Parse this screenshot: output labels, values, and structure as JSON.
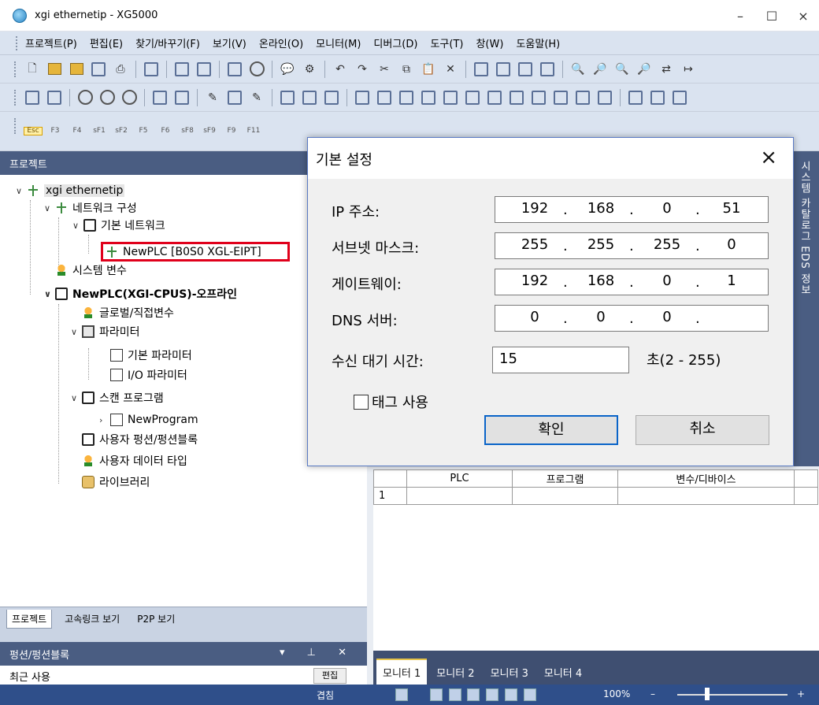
{
  "window": {
    "title": "xgi ethernetip - XG5000",
    "min": "–",
    "max": "☐",
    "close": "×"
  },
  "menu": [
    "프로젝트(P)",
    "편집(E)",
    "찾기/바꾸기(F)",
    "보기(V)",
    "온라인(O)",
    "모니터(M)",
    "디버그(D)",
    "도구(T)",
    "창(W)",
    "도움말(H)"
  ],
  "toolbar_keys": [
    {
      "top": "Esc",
      "bottom": ""
    },
    {
      "top": "F3",
      "bottom": ""
    },
    {
      "top": "F4",
      "bottom": ""
    },
    {
      "top": "sF1",
      "bottom": ""
    },
    {
      "top": "sF2",
      "bottom": ""
    },
    {
      "top": "F5",
      "bottom": ""
    },
    {
      "top": "F6",
      "bottom": ""
    },
    {
      "top": "sF8",
      "bottom": ""
    },
    {
      "top": "sF9",
      "bottom": ""
    },
    {
      "top": "F9",
      "bottom": ""
    },
    {
      "top": "F11",
      "bottom": ""
    }
  ],
  "project_pane": {
    "title": "프로젝트",
    "tree": [
      {
        "label": "xgi ethernetip",
        "icon": "network-icon"
      },
      {
        "label": "네트워크 구성",
        "icon": "network-config-icon"
      },
      {
        "label": "기본 네트워크",
        "icon": "basic-network-icon"
      },
      {
        "label": "NewPLC [B0S0 XGL-EIPT]",
        "icon": "module-icon"
      },
      {
        "label": "시스템 변수",
        "icon": "system-variable-icon"
      },
      {
        "label": "NewPLC(XGI-CPUS)-오프라인",
        "icon": "plc-icon"
      },
      {
        "label": "글로벌/직접변수",
        "icon": "global-variable-icon"
      },
      {
        "label": "파라미터",
        "icon": "parameter-icon"
      },
      {
        "label": "기본 파라미터",
        "icon": "basic-parameter-icon"
      },
      {
        "label": "I/O 파라미터",
        "icon": "io-parameter-icon"
      },
      {
        "label": "스캔 프로그램",
        "icon": "scan-program-icon"
      },
      {
        "label": "NewProgram",
        "icon": "program-icon"
      },
      {
        "label": "사용자 펑션/펑션블록",
        "icon": "user-function-icon"
      },
      {
        "label": "사용자 데이터 타입",
        "icon": "user-datatype-icon"
      },
      {
        "label": "라이브러리",
        "icon": "library-icon"
      }
    ],
    "bottom_tabs": [
      "프로젝트",
      "고속링크 보기",
      "P2P 보기"
    ]
  },
  "function_pane": {
    "title": "펑션/펑션블록",
    "recent": "최근 사용",
    "edit_button": "편집"
  },
  "side_strip": "시스템 카탈로그  EDS 정보",
  "monitor": {
    "columns": [
      "",
      "PLC",
      "프로그램",
      "변수/디바이스"
    ],
    "rows": [
      [
        "1",
        "",
        "",
        ""
      ]
    ],
    "tabs": [
      "모니터 1",
      "모니터 2",
      "모니터 3",
      "모니터 4"
    ]
  },
  "status": {
    "overwrite": "겹침",
    "zoom": "100%",
    "minus": "–",
    "plus": "+"
  },
  "dialog": {
    "title": "기본 설정",
    "close": "×",
    "ip_label": "IP 주소:",
    "ip": [
      "192",
      "168",
      "0",
      "51"
    ],
    "subnet_label": "서브넷 마스크:",
    "subnet": [
      "255",
      "255",
      "255",
      "0"
    ],
    "gateway_label": "게이트웨이:",
    "gateway": [
      "192",
      "168",
      "0",
      "1"
    ],
    "dns_label": "DNS 서버:",
    "dns": [
      "0",
      "0",
      "0",
      ""
    ],
    "timeout_label": "수신 대기 시간:",
    "timeout_value": "15",
    "timeout_range": "초(2 - 255)",
    "tag_checkbox": "태그 사용",
    "ok": "확인",
    "cancel": "취소"
  },
  "dot": "."
}
